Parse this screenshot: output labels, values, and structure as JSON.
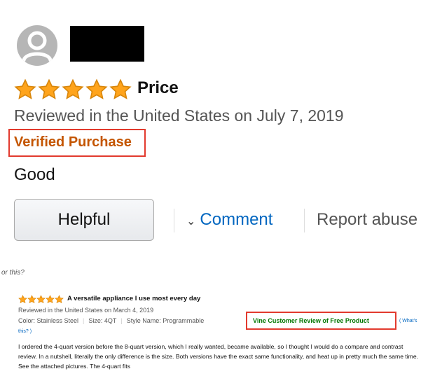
{
  "review_top": {
    "rating_stars": 5,
    "title": "Price",
    "reviewed_line": "Reviewed in the United States on July 7, 2019",
    "verified_label": "Verified Purchase",
    "body": "Good",
    "helpful_label": "Helpful",
    "comment_label": "Comment",
    "report_label": "Report abuse"
  },
  "review_bottom": {
    "prefix_text": "or this?",
    "rating_stars": 5,
    "title": "A versatile appliance I use most every day",
    "reviewed_line": "Reviewed in the United States on March 4, 2019",
    "color": "Color: Stainless Steel",
    "size": "Size: 4QT",
    "style": "Style Name: Programmable",
    "vine_label": "Vine Customer Review of Free Product",
    "whats_this_1": "( What's",
    "whats_this_2": "this? )",
    "body": "I ordered the 4-quart version before the 8-quart version, which I really wanted, became available, so I thought I would do a compare and contrast review. In a nutshell, literally the only difference is the size. Both versions have the exact same functionality, and heat up in pretty much the same time. See the attached pictures. The 4-quart fits"
  },
  "colors": {
    "star": "#ffa41c",
    "verified": "#c45500",
    "link": "#0066c0",
    "vine": "#007600",
    "highlight_box": "#e23a2e"
  },
  "icons": [
    "user-avatar-icon",
    "star-icon",
    "chevron-down-icon"
  ]
}
